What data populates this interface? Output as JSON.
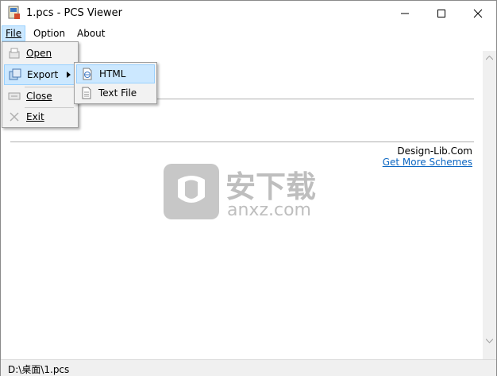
{
  "window": {
    "title": "1.pcs - PCS Viewer"
  },
  "menubar": {
    "items": [
      {
        "label": "File"
      },
      {
        "label": "Option"
      },
      {
        "label": "About"
      }
    ]
  },
  "file_menu": {
    "items": [
      {
        "label": "Open"
      },
      {
        "label": "Export"
      },
      {
        "label": "Close"
      },
      {
        "label": "Exit"
      }
    ]
  },
  "export_menu": {
    "items": [
      {
        "label": "HTML"
      },
      {
        "label": "Text File"
      }
    ]
  },
  "content": {
    "brand": "Design-Lib.Com",
    "link": "Get More Schemes",
    "watermark_text": "安下载",
    "watermark_domain": "anxz.com"
  },
  "status": {
    "path": "D:\\桌面\\1.pcs"
  },
  "colors": {
    "menu_highlight": "#cce8ff",
    "link": "#0b66c2"
  }
}
